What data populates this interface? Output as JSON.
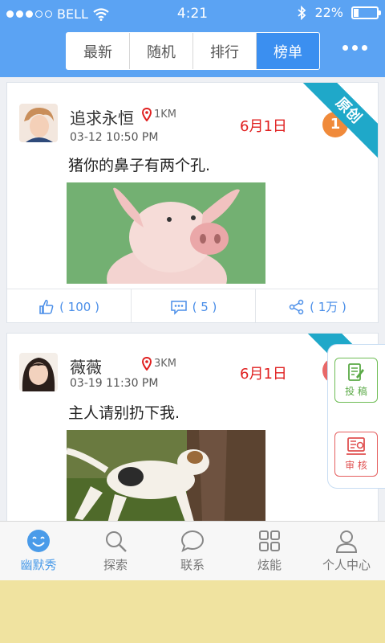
{
  "status_bar": {
    "carrier": "BELL",
    "time": "4:21",
    "battery": "22%",
    "battery_level": 0.22,
    "signal_bars": 3
  },
  "tabs": [
    {
      "label": "最新",
      "active": false
    },
    {
      "label": "随机",
      "active": false
    },
    {
      "label": "排行",
      "active": false
    },
    {
      "label": "榜单",
      "active": true
    }
  ],
  "posts": [
    {
      "username": "追求永恒",
      "distance": "1KM",
      "time": "03-12  10:50  PM",
      "date": "6月1日",
      "rank": "1",
      "ribbon": "原创",
      "text": "猪你的鼻子有两个孔.",
      "likes": "( 100 )",
      "comments": "( 5 )",
      "shares": "( 1万 )"
    },
    {
      "username": "薇薇",
      "distance": "3KM",
      "time": "03-19  11:30  PM",
      "date": "6月1日",
      "text": "主人请别扔下我."
    }
  ],
  "side_panel": {
    "post_label": "投 稿",
    "review_label": "审 核"
  },
  "bottom_nav": [
    {
      "label": "幽默秀",
      "icon": "smile-icon",
      "active": true
    },
    {
      "label": "探索",
      "icon": "search-icon",
      "active": false
    },
    {
      "label": "联系",
      "icon": "chat-icon",
      "active": false
    },
    {
      "label": "炫能",
      "icon": "grid-icon",
      "active": false
    },
    {
      "label": "个人中心",
      "icon": "person-icon",
      "active": false
    }
  ],
  "colors": {
    "header": "#5ba3f3",
    "active_tab": "#3b8ff0",
    "accent": "#4a8ee8",
    "date_red": "#e02020",
    "ribbon": "#1fa8c9"
  }
}
